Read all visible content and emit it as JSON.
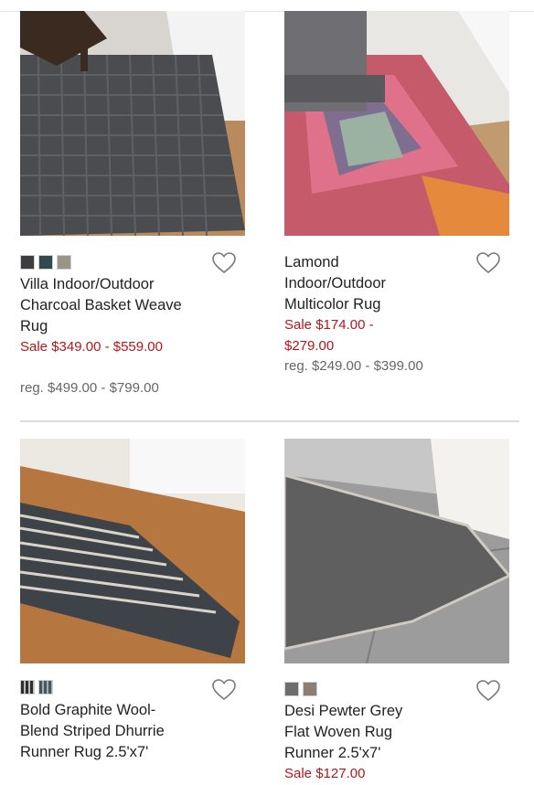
{
  "products": [
    {
      "name": "Villa Indoor/Outdoor Charcoal Basket Weave Rug",
      "sale": "Sale $349.00 - $559.00",
      "reg": "reg. $499.00 - $799.00",
      "swatches": [
        "#3c3d3f",
        "#2f4a4c",
        "#9a948a"
      ],
      "favorite_icon": "heart-outline-icon"
    },
    {
      "name": "Lamond Indoor/Outdoor Multicolor Rug",
      "sale": "Sale $174.00 - $279.00",
      "reg": "reg. $249.00 - $399.00",
      "swatches": [],
      "favorite_icon": "heart-outline-icon"
    },
    {
      "name": "Bold Graphite Wool-Blend Striped Dhurrie Runner Rug 2.5'x7'",
      "sale": "",
      "reg": "",
      "swatches": [
        "stripe-dark",
        "stripe-teal"
      ],
      "favorite_icon": "heart-outline-icon"
    },
    {
      "name": "Desi Pewter Grey Flat Woven Rug Runner 2.5'x7'",
      "sale": "Sale $127.00",
      "reg": "",
      "swatches": [
        "#6d6d6d",
        "#8c7e72"
      ],
      "favorite_icon": "heart-outline-icon"
    }
  ],
  "colors": {
    "sale": "#b3161b",
    "reg": "#666666",
    "text": "#222222"
  }
}
